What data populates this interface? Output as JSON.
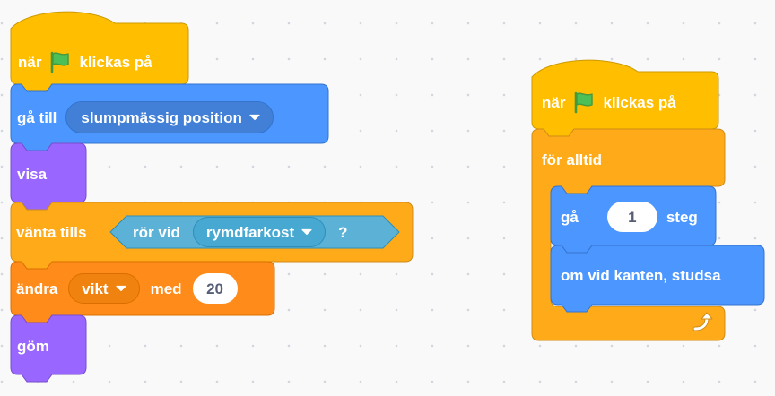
{
  "workspace": {
    "background": "#f9f9fa",
    "colors": {
      "events": "#ffbf00",
      "motion": "#4c97ff",
      "looks": "#9966ff",
      "control": "#ffab19",
      "variables": "#ff8c1a",
      "sensing": "#5cb1d6"
    }
  },
  "script1": {
    "hat": {
      "prefix": "när",
      "flag_icon": "green-flag-icon",
      "suffix": "klickas på"
    },
    "goto": {
      "label": "gå till",
      "menu_value": "slumpmässig position",
      "arrow_icon": "dropdown-arrow-icon"
    },
    "show": {
      "label": "visa"
    },
    "wait_until": {
      "label": "vänta tills",
      "touching": {
        "label": "rör vid",
        "menu_value": "rymdfarkost",
        "arrow_icon": "dropdown-arrow-icon",
        "question": "?"
      }
    },
    "change": {
      "label": "ändra",
      "variable": "vikt",
      "arrow_icon": "dropdown-arrow-icon",
      "by_label": "med",
      "value": "20"
    },
    "hide": {
      "label": "göm"
    }
  },
  "script2": {
    "hat": {
      "prefix": "när",
      "flag_icon": "green-flag-icon",
      "suffix": "klickas på"
    },
    "forever": {
      "label": "för alltid",
      "loop_icon": "loop-arrow-icon"
    },
    "move": {
      "label": "gå",
      "value": "1",
      "suffix": "steg"
    },
    "bounce": {
      "label": "om vid kanten, studsa"
    }
  }
}
